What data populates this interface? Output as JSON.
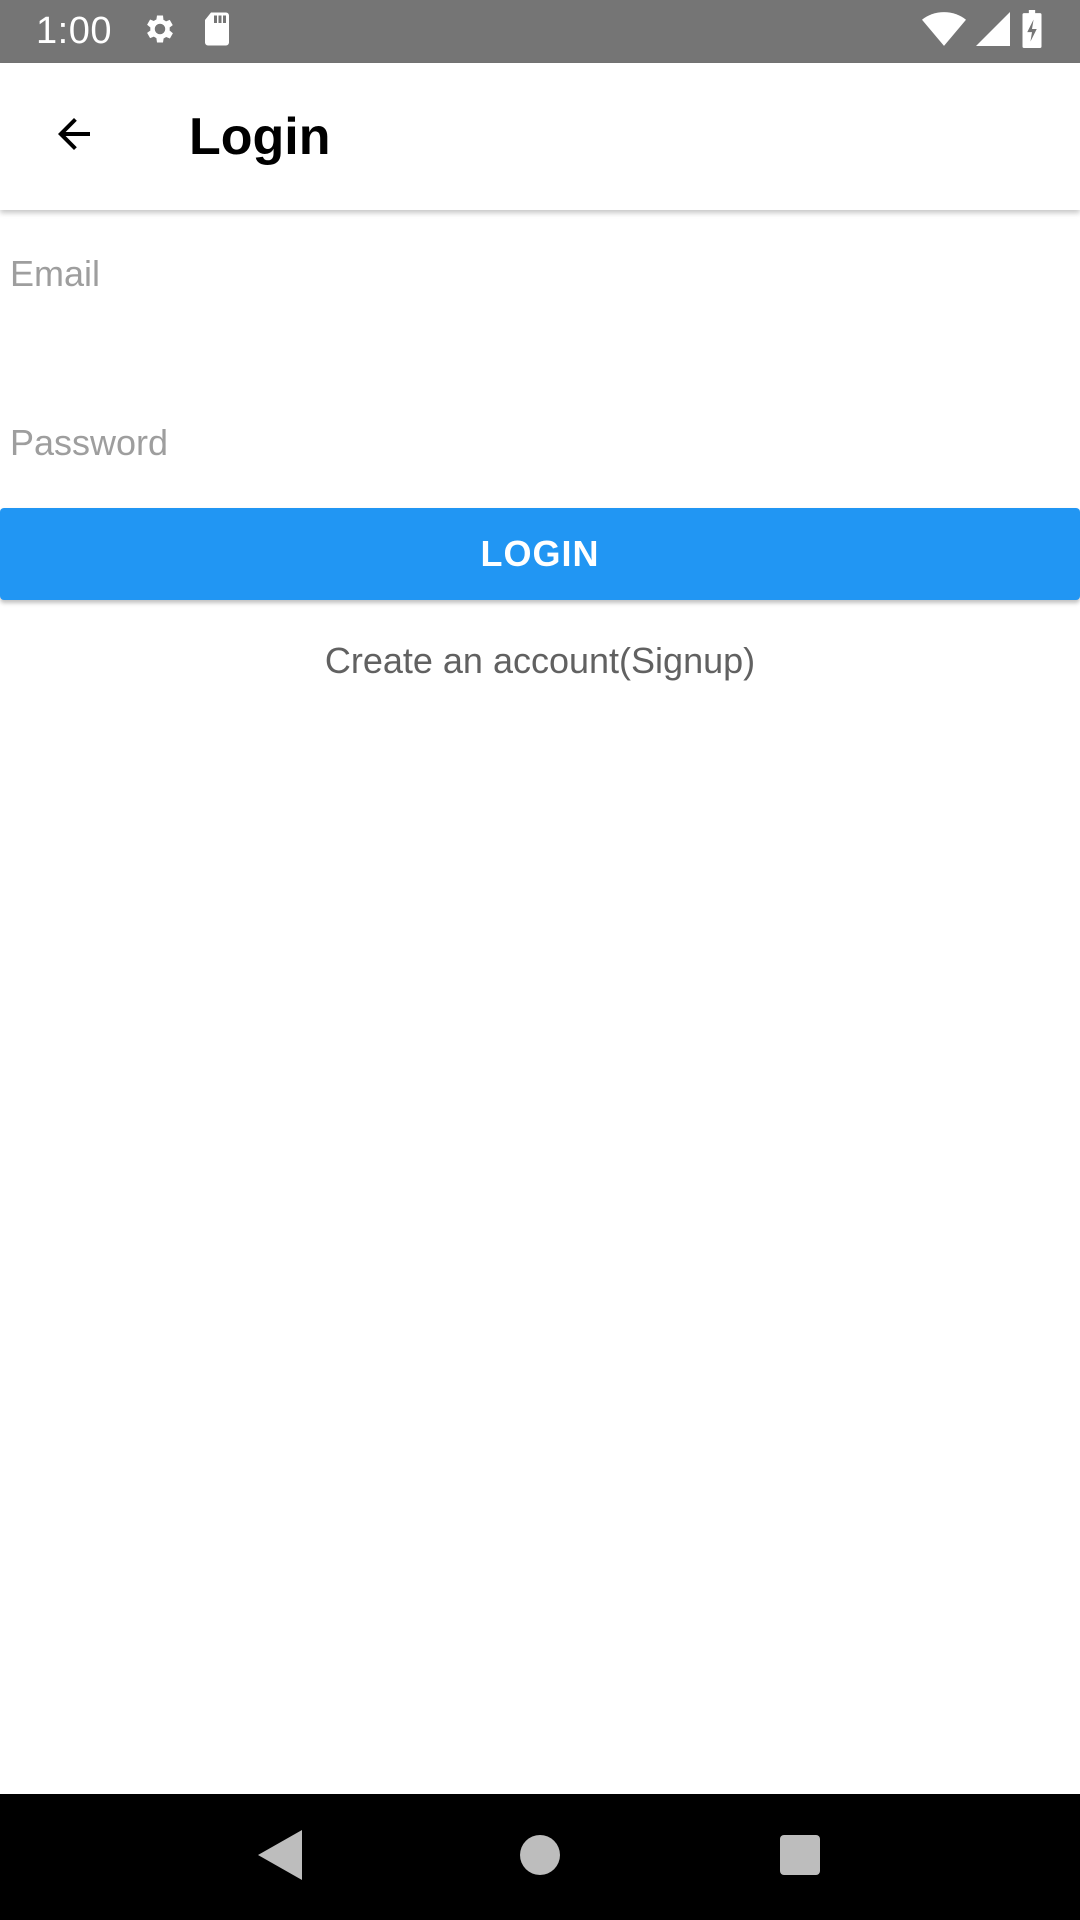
{
  "status_bar": {
    "time": "1:00",
    "icons_left": [
      "gear-icon",
      "sd-card-icon"
    ],
    "icons_right": [
      "wifi-icon",
      "signal-icon",
      "battery-charging-icon"
    ]
  },
  "app_bar": {
    "title": "Login",
    "back_icon": "arrow-back-icon"
  },
  "form": {
    "email_placeholder": "Email",
    "email_value": "",
    "password_placeholder": "Password",
    "password_value": "",
    "login_label": "LOGIN",
    "signup_label": "Create an account(Signup)"
  },
  "nav_bar": {
    "icons": [
      "back-triangle-icon",
      "home-circle-icon",
      "recents-square-icon"
    ]
  },
  "colors": {
    "status_bar": "#757575",
    "accent": "#2196f3",
    "nav_bar": "#000000"
  }
}
